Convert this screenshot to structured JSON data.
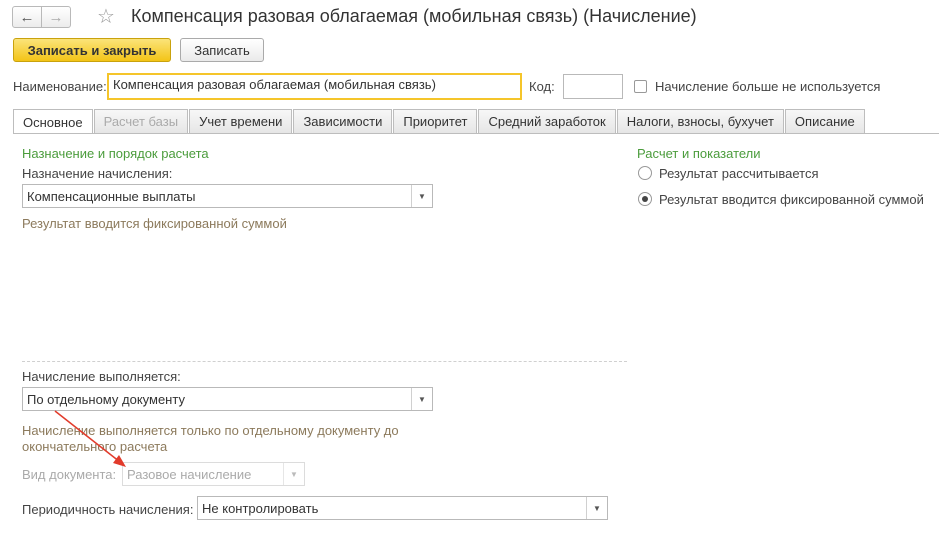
{
  "window": {
    "title": "Компенсация разовая облагаемая (мобильная связь) (Начисление)",
    "back_icon": "arrow-left",
    "forward_icon": "arrow-right",
    "favorite_icon": "star"
  },
  "toolbar": {
    "save_close_label": "Записать и закрыть",
    "save_label": "Записать"
  },
  "header": {
    "name_label": "Наименование:",
    "name_value": "Компенсация разовая облагаемая (мобильная связь)",
    "code_label": "Код:",
    "code_value": "",
    "unused_label": "Начисление больше не используется"
  },
  "tabs": [
    {
      "label": "Основное",
      "state": "active"
    },
    {
      "label": "Расчет базы",
      "state": "disabled"
    },
    {
      "label": "Учет времени",
      "state": "normal"
    },
    {
      "label": "Зависимости",
      "state": "normal"
    },
    {
      "label": "Приоритет",
      "state": "normal"
    },
    {
      "label": "Средний заработок",
      "state": "normal"
    },
    {
      "label": "Налоги, взносы, бухучет",
      "state": "normal"
    },
    {
      "label": "Описание",
      "state": "normal"
    }
  ],
  "main": {
    "section_title": "Назначение и порядок расчета",
    "purpose_label": "Назначение начисления:",
    "purpose_value": "Компенсационные выплаты",
    "purpose_hint": "Результат вводится фиксированной суммой",
    "calc_label": "Начисление выполняется:",
    "calc_value": "По отдельному документу",
    "calc_hint": "Начисление выполняется только по отдельному документу до окончательного расчета",
    "doc_type_label": "Вид документа:",
    "doc_type_value": "Разовое начисление",
    "periodicity_label": "Периодичность начисления:",
    "periodicity_value": "Не контролировать"
  },
  "right": {
    "section_title": "Расчет и показатели",
    "radio_calc_label": "Результат рассчитывается",
    "radio_fixed_label": "Результат вводится фиксированной суммой",
    "selected": "fixed"
  },
  "colors": {
    "accent_green": "#4b9c3c",
    "primary_button": "#f3c417",
    "focus_border": "#f5c52a",
    "hint_text": "#8c7a5c",
    "annotation_arrow": "#e23b2b"
  }
}
